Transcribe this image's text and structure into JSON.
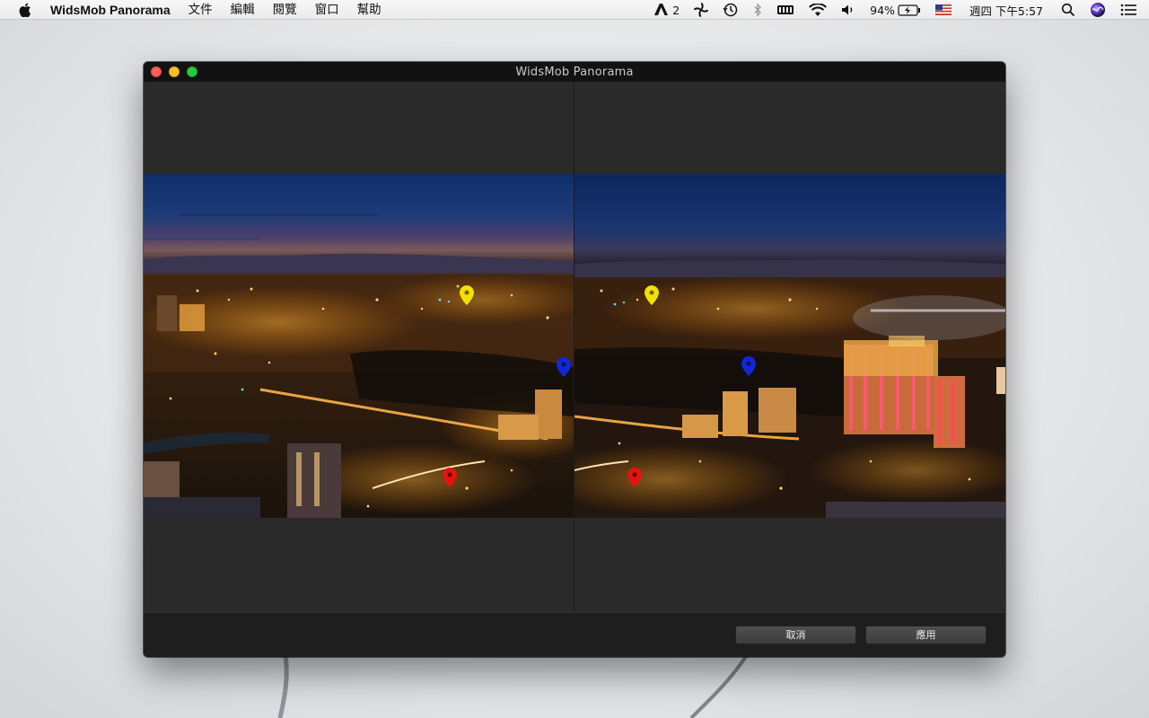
{
  "menubar": {
    "app_name": "WidsMob Panorama",
    "items": [
      "文件",
      "編輯",
      "閱覽",
      "窗口",
      "幫助"
    ],
    "status": {
      "adobe_count": "2",
      "battery": "94%",
      "clock": "週四 下午5:57"
    },
    "icons": [
      "apple-icon",
      "adobe-icon",
      "fan-icon",
      "time-machine-icon",
      "bluetooth-icon",
      "memory-icon",
      "wifi-icon",
      "volume-icon",
      "battery-icon",
      "flag-icon",
      "search-icon",
      "siri-icon",
      "notification-center-icon"
    ]
  },
  "window": {
    "title": "WidsMob Panorama",
    "left_image": "night-city-panorama-left",
    "right_image": "night-city-panorama-right",
    "markers": {
      "colors": {
        "yellow": "#f2e100",
        "blue": "#1228d6",
        "red": "#e3140f"
      }
    },
    "buttons": {
      "cancel": "取消",
      "apply": "應用"
    }
  }
}
